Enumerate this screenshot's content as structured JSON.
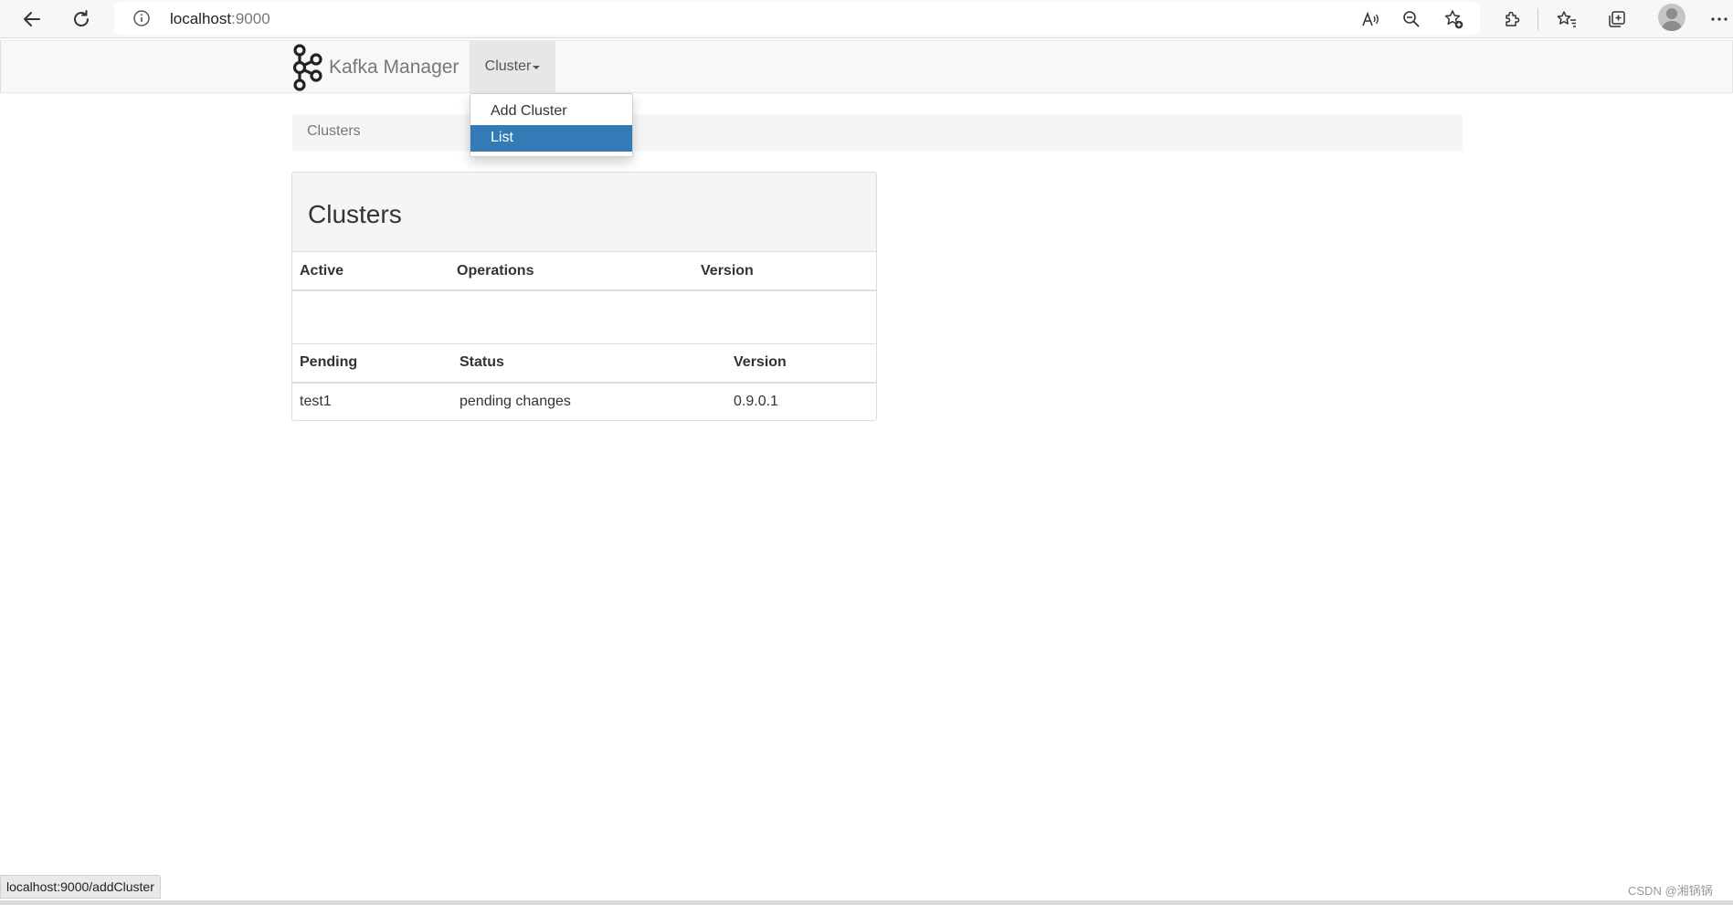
{
  "browser": {
    "url_host": "localhost",
    "url_port": ":9000"
  },
  "app": {
    "brand": "Kafka Manager",
    "nav_cluster": "Cluster"
  },
  "dropdown": {
    "items": [
      {
        "label": "Add Cluster",
        "active": false
      },
      {
        "label": "List",
        "active": true
      }
    ],
    "active_color": "#337ab7"
  },
  "breadcrumb": {
    "label": "Clusters"
  },
  "panel": {
    "title": "Clusters",
    "active_table": {
      "headers": [
        "Active",
        "Operations",
        "Version"
      ],
      "rows": []
    },
    "pending_table": {
      "headers": [
        "Pending",
        "Status",
        "Version"
      ],
      "rows": [
        {
          "name": "test1",
          "status": "pending changes",
          "version": "0.9.0.1"
        }
      ]
    }
  },
  "status_bar": {
    "url": "localhost:9000/addCluster"
  },
  "watermark": "CSDN @湘锅锅"
}
